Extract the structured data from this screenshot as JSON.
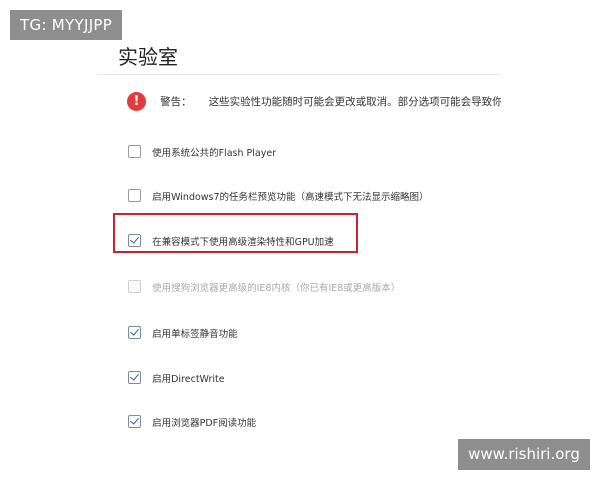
{
  "watermark_top": "TG: MYYJJPP",
  "watermark_bottom": "www.rishiri.org",
  "page_title": "实验室",
  "warning": {
    "icon": "exclamation-icon",
    "icon_glyph": "!",
    "label": "警告：",
    "text": "这些实验性功能随时可能会更改或取消。部分选项可能会导致你的"
  },
  "options": [
    {
      "label": "使用系统公共的Flash Player",
      "checked": false,
      "disabled": false
    },
    {
      "label": "启用Windows7的任务栏预览功能（高速模式下无法显示缩略图）",
      "checked": false,
      "disabled": false
    },
    {
      "label": "在兼容模式下使用高级渲染特性和GPU加速",
      "checked": true,
      "disabled": false,
      "highlighted": true
    },
    {
      "label": "使用搜狗浏览器更高级的IE8内核（你已有IE8或更高版本）",
      "checked": false,
      "disabled": true
    },
    {
      "label": "启用单标签静音功能",
      "checked": true,
      "disabled": false
    },
    {
      "label": "启用DirectWrite",
      "checked": true,
      "disabled": false
    },
    {
      "label": "启用浏览器PDF阅读功能",
      "checked": true,
      "disabled": false
    }
  ],
  "colors": {
    "highlight_border": "#c8242f",
    "warning_icon": "#e23b3b",
    "check_mark": "#2a5db0"
  }
}
